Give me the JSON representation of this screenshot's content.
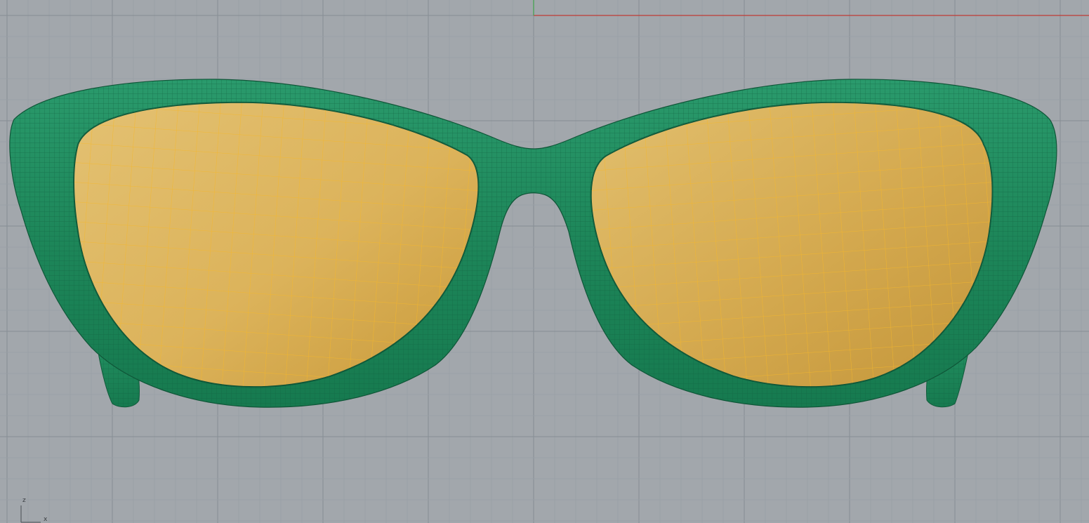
{
  "viewport": {
    "background_color": "#a2a7ac",
    "grid_minor_color": "#99a0a6",
    "grid_major_color": "#868d94",
    "x_axis_color": "#c03b35",
    "y_axis_color": "#3da34a"
  },
  "model": {
    "frame_color": "#1f8a5e",
    "frame_wire_color": "#14633f",
    "lens_color": "#d9b04f",
    "lens_wire_color": "#f2b630"
  },
  "axis_gizmo": {
    "z_label": "z",
    "x_label": "x",
    "icon": "axis-gizmo-icon"
  }
}
